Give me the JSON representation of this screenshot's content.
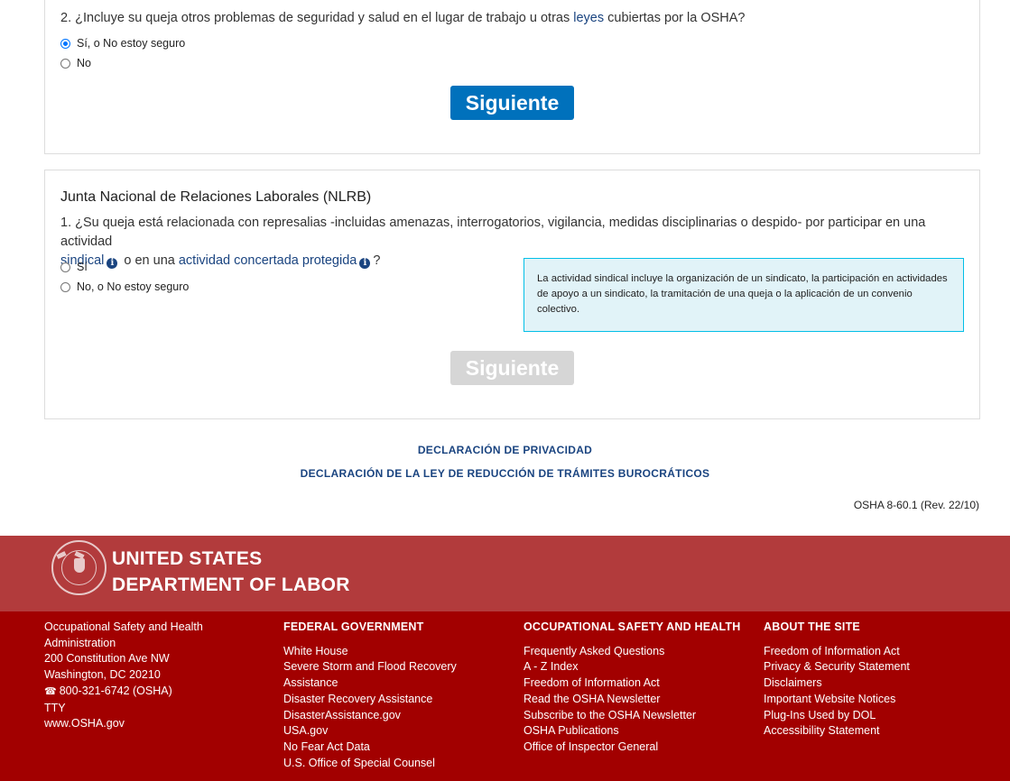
{
  "question2": {
    "prefix": "2. ¿Incluye su queja otros problemas de seguridad y salud en el lugar de trabajo u otras ",
    "link": "leyes",
    "suffix": " cubiertas por la OSHA?",
    "options": [
      "Sí, o No estoy seguro",
      "No"
    ],
    "selected": 0,
    "button": "Siguiente"
  },
  "nlrb": {
    "title": "Junta Nacional de Relaciones Laborales (NLRB)",
    "question_line1": "1. ¿Su queja está relacionada con represalias -incluidas amenazas, interrogatorios, vigilancia, medidas disciplinarias o despido- por participar en una actividad",
    "link1": "sindical",
    "middle": " o en una ",
    "link2": "actividad concertada protegida",
    "end": "?",
    "options": [
      "Sí",
      "No, o No estoy seguro"
    ],
    "info_box": "La actividad sindical incluye la organización de un sindicato, la participación en actividades de apoyo a un sindicato, la tramitación de una queja o la aplicación de un convenio colectivo.",
    "button": "Siguiente"
  },
  "links": {
    "privacy": "DECLARACIÓN DE PRIVACIDAD",
    "paperwork": "DECLARACIÓN DE LA LEY DE REDUCCIÓN DE TRÁMITES BUROCRÁTICOS"
  },
  "form_id": "OSHA 8-60.1 (Rev. 22/10)",
  "footer": {
    "dol_line1": "UNITED STATES",
    "dol_line2": "DEPARTMENT OF LABOR",
    "contact": {
      "org": "Occupational Safety and Health Administration",
      "address1": "200 Constitution Ave NW",
      "address2": "Washington, DC 20210",
      "phone": "800-321-6742 (OSHA)",
      "tty": "TTY",
      "website": "www.OSHA.gov"
    },
    "federal": {
      "heading": "FEDERAL GOVERNMENT",
      "items": [
        "White House",
        "Severe Storm and Flood Recovery Assistance",
        "Disaster Recovery Assistance",
        "DisasterAssistance.gov",
        "USA.gov",
        "No Fear Act Data",
        "U.S. Office of Special Counsel"
      ]
    },
    "osha": {
      "heading": "OCCUPATIONAL SAFETY AND HEALTH",
      "items": [
        "Frequently Asked Questions",
        "A - Z Index",
        "Freedom of Information Act",
        "Read the OSHA Newsletter",
        "Subscribe to the OSHA Newsletter",
        "OSHA Publications",
        "Office of Inspector General"
      ]
    },
    "about": {
      "heading": "ABOUT THE SITE",
      "items": [
        "Freedom of Information Act",
        "Privacy & Security Statement",
        "Disclaimers",
        "Important Website Notices",
        "Plug-Ins Used by DOL",
        "Accessibility Statement"
      ]
    }
  },
  "colors": {
    "primary_button": "#0071bc",
    "disabled_button": "#d6d6d6",
    "link": "#1a4480",
    "footer_top": "#b23b3c",
    "footer_main": "#a20000",
    "info_box_bg": "#e1f3f8",
    "info_box_border": "#02bfe7"
  }
}
